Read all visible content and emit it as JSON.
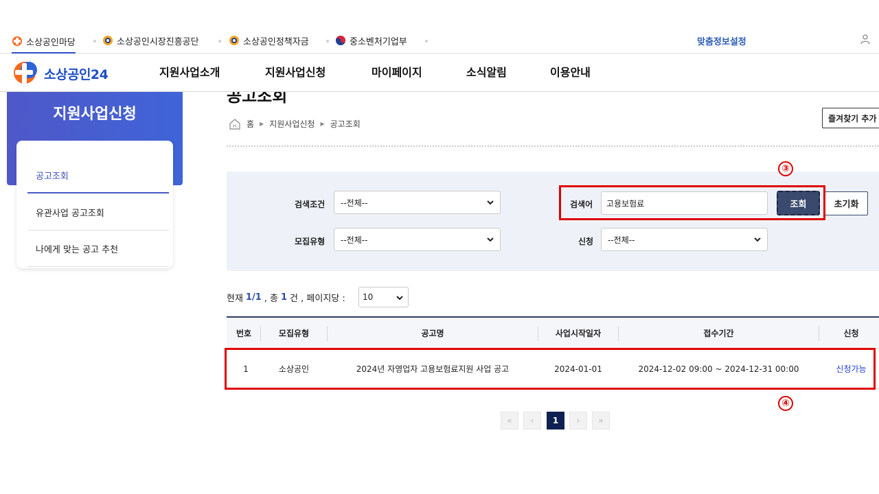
{
  "topbar": {
    "sites": [
      {
        "label": "소상공인마당"
      },
      {
        "label": "소상공인시장진흥공단"
      },
      {
        "label": "소상공인정책자금"
      },
      {
        "label": "중소벤처기업부"
      }
    ],
    "custom_info": "맞춤정보설정"
  },
  "gnb": {
    "brand": "소상공인24",
    "menu": [
      "지원사업소개",
      "지원사업신청",
      "마이페이지",
      "소식알림",
      "이용안내"
    ]
  },
  "sidebar": {
    "title": "지원사업신청",
    "items": [
      {
        "label": "공고조회"
      },
      {
        "label": "유관사업 공고조회"
      },
      {
        "label": "나에게 맞는 공고 추천"
      }
    ]
  },
  "page": {
    "title": "공고조회",
    "breadcrumb": [
      "홈",
      "지원사업신청",
      "공고조회"
    ],
    "favorite_button": "즐겨찾기 추가"
  },
  "search": {
    "condition_label": "검색조건",
    "condition_value": "--전체--",
    "keyword_label": "검색어",
    "keyword_value": "고용보험료",
    "search_button": "조회",
    "reset_button": "초기화",
    "recruit_label": "모집유형",
    "recruit_value": "--전체--",
    "apply_label": "신청",
    "apply_value": "--전체--"
  },
  "summary": {
    "current_prefix": "현재",
    "current": "1/1",
    "total_prefix": ", 총",
    "total": "1",
    "total_suffix": "건 , 페이지당 :",
    "per_page": "10"
  },
  "table": {
    "headers": [
      "번호",
      "모집유형",
      "공고명",
      "사업시작일자",
      "접수기간",
      "신청"
    ],
    "rows": [
      [
        "1",
        "소상공인",
        "2024년 자영업자 고용보험료지원 사업 공고",
        "2024-01-01",
        "2024-12-02 09:00 ~ 2024-12-31 00:00",
        "신청가능"
      ]
    ]
  },
  "pagination": {
    "first": "«",
    "prev": "‹",
    "current": "1",
    "next": "›",
    "last": "»"
  },
  "annotations": {
    "marker_search": "③",
    "marker_result": "④",
    "color": "#e00000"
  },
  "colors": {
    "brand_blue": "#1f4fc5",
    "navy": "#3a4a6e",
    "link_blue": "#1f3fd1"
  }
}
